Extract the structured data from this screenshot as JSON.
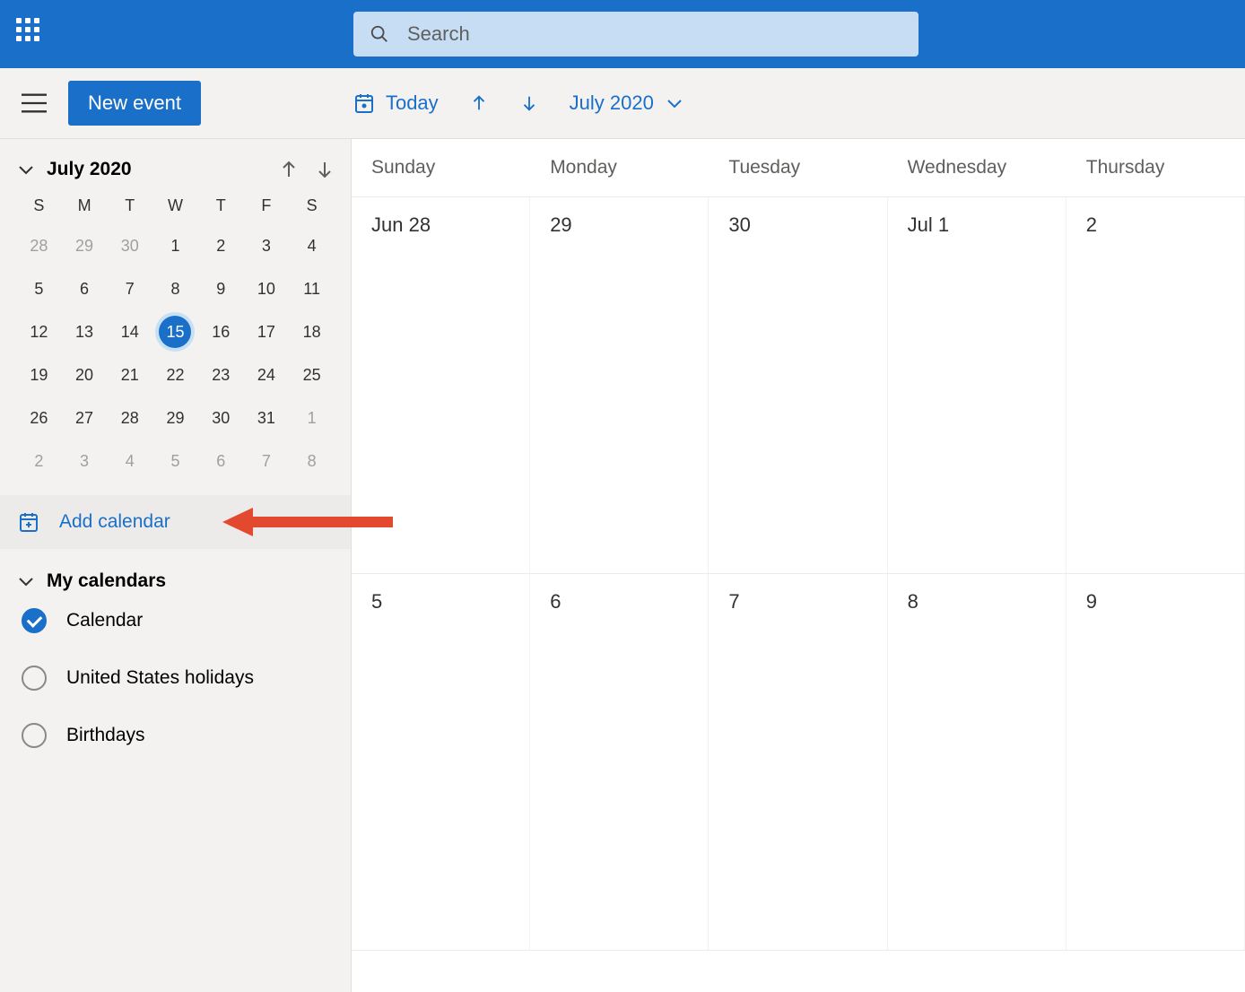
{
  "header": {
    "search_placeholder": "Search"
  },
  "commandbar": {
    "new_event": "New event",
    "today": "Today",
    "month_label": "July 2020"
  },
  "mini_calendar": {
    "label": "July 2020",
    "dow": [
      "S",
      "M",
      "T",
      "W",
      "T",
      "F",
      "S"
    ],
    "weeks": [
      [
        {
          "d": "28",
          "dim": true
        },
        {
          "d": "29",
          "dim": true
        },
        {
          "d": "30",
          "dim": true
        },
        {
          "d": "1"
        },
        {
          "d": "2"
        },
        {
          "d": "3"
        },
        {
          "d": "4"
        }
      ],
      [
        {
          "d": "5"
        },
        {
          "d": "6"
        },
        {
          "d": "7"
        },
        {
          "d": "8"
        },
        {
          "d": "9"
        },
        {
          "d": "10"
        },
        {
          "d": "11"
        }
      ],
      [
        {
          "d": "12"
        },
        {
          "d": "13"
        },
        {
          "d": "14"
        },
        {
          "d": "15",
          "today": true
        },
        {
          "d": "16"
        },
        {
          "d": "17"
        },
        {
          "d": "18"
        }
      ],
      [
        {
          "d": "19"
        },
        {
          "d": "20"
        },
        {
          "d": "21"
        },
        {
          "d": "22"
        },
        {
          "d": "23"
        },
        {
          "d": "24"
        },
        {
          "d": "25"
        }
      ],
      [
        {
          "d": "26"
        },
        {
          "d": "27"
        },
        {
          "d": "28"
        },
        {
          "d": "29"
        },
        {
          "d": "30"
        },
        {
          "d": "31"
        },
        {
          "d": "1",
          "dim": true
        }
      ],
      [
        {
          "d": "2",
          "dim": true
        },
        {
          "d": "3",
          "dim": true
        },
        {
          "d": "4",
          "dim": true
        },
        {
          "d": "5",
          "dim": true
        },
        {
          "d": "6",
          "dim": true
        },
        {
          "d": "7",
          "dim": true
        },
        {
          "d": "8",
          "dim": true
        }
      ]
    ]
  },
  "add_calendar_label": "Add calendar",
  "calendar_section": {
    "title": "My calendars",
    "items": [
      {
        "label": "Calendar",
        "checked": true
      },
      {
        "label": "United States holidays",
        "checked": false
      },
      {
        "label": "Birthdays",
        "checked": false
      }
    ]
  },
  "grid": {
    "day_headers": [
      "Sunday",
      "Monday",
      "Tuesday",
      "Wednesday",
      "Thursday"
    ],
    "rows": [
      [
        "Jun 28",
        "29",
        "30",
        "Jul 1",
        "2"
      ],
      [
        "5",
        "6",
        "7",
        "8",
        "9"
      ]
    ]
  }
}
